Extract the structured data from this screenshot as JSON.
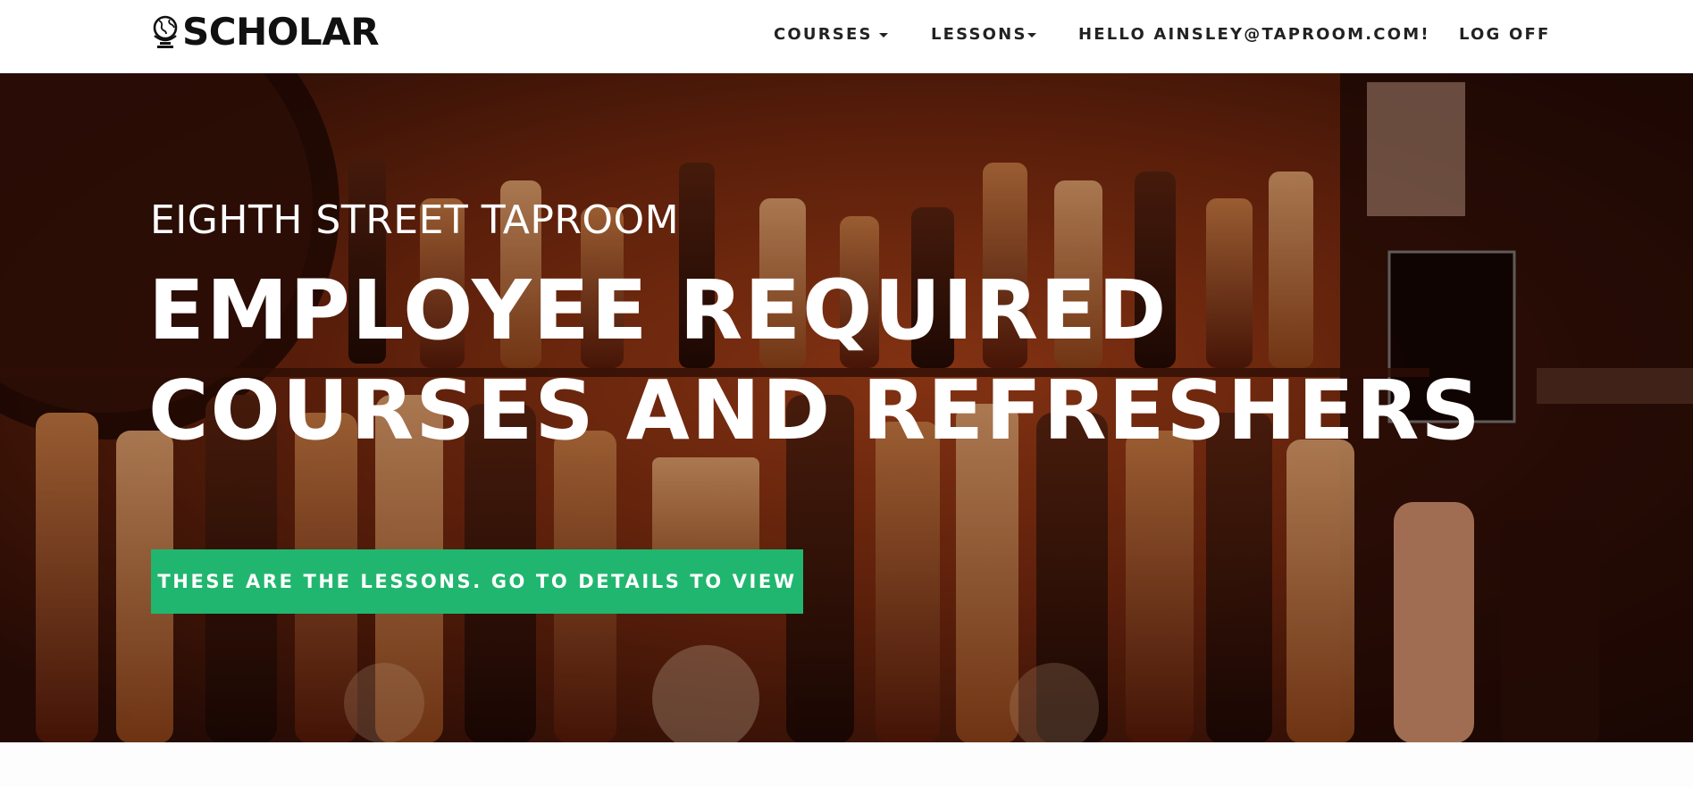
{
  "brand": {
    "name": "SCHOLAR",
    "icon": "globe-icon"
  },
  "nav": {
    "courses": "COURSES",
    "lessons": "LESSONS",
    "greeting": "HELLO AINSLEY@TAPROOM.COM!",
    "logoff": "LOG OFF"
  },
  "hero": {
    "kicker": "EIGHTH STREET TAPROOM",
    "title_line1": "EMPLOYEE REQUIRED",
    "title_line2": "COURSES AND REFRESHERS",
    "cta": "THESE ARE THE LESSONS. GO TO DETAILS TO VIEW",
    "background": "bar-shelves-with-liquor-bottles"
  },
  "colors": {
    "accent": "#21b66f",
    "nav_text": "#222222",
    "hero_text": "#ffffff"
  }
}
